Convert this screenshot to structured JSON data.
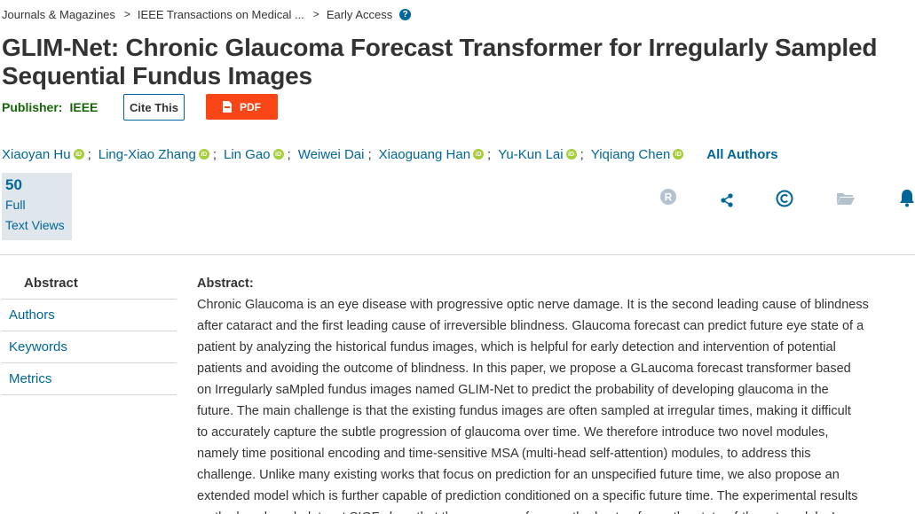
{
  "breadcrumb": {
    "items": [
      "Journals & Magazines",
      "IEEE Transactions on Medical ...",
      "Early Access"
    ],
    "separator": ">"
  },
  "title_lines": [
    "GLIM-Net: Chronic Glaucoma Forecast Transformer for Irregularly Sampled",
    "Sequential Fundus Images"
  ],
  "publisher": {
    "label": "Publisher:",
    "value": "IEEE"
  },
  "buttons": {
    "cite": "Cite This",
    "pdf": "PDF"
  },
  "authors": [
    "Xiaoyan Hu",
    "Ling-Xiao Zhang",
    "Lin Gao",
    "Weiwei Dai",
    "Xiaoguang Han",
    "Yu-Kun Lai",
    "Yiqiang Chen"
  ],
  "author_separator": ";",
  "all_authors": "All Authors",
  "metrics": {
    "count": "50",
    "label_line1": "Full",
    "label_line2": "Text Views"
  },
  "action_icons": [
    "rights-icon",
    "share-icon",
    "copyright-icon",
    "folder-icon",
    "alert-bell-icon"
  ],
  "nav": {
    "items": [
      "Abstract",
      "Authors",
      "Keywords",
      "Metrics"
    ],
    "active": "Abstract"
  },
  "abstract": {
    "heading": "Abstract:",
    "lines": [
      "Chronic Glaucoma is an eye disease with progressive optic nerve damage. It is the second leading cause of blindness",
      "after cataract and the first leading cause of irreversible blindness. Glaucoma forecast can predict future eye state of a",
      "patient by analyzing the historical fundus images, which is helpful for early detection and intervention of potential",
      "patients and avoiding the outcome of blindness. In this paper, we propose a GLaucoma forecast transformer based",
      "on Irregularly saMpled fundus images named GLIM-Net to predict the probability of developing glaucoma in the",
      "future. The main challenge is that the existing fundus images are often sampled at irregular times, making it difficult",
      "to accurately capture the subtle progression of glaucoma over time. We therefore introduce two novel modules,",
      "namely time positional encoding and time-sensitive MSA (multi-head self-attention) modules, to address this",
      "challenge. Unlike many existing works that focus on prediction for an unspecified future time, we also propose an",
      "extended model which is further capable of prediction conditioned on a specific future time. The experimental results",
      "on the benchmark dataset SIGF show that the accuracy of our method outperforms the state-of-the-art models. In"
    ]
  },
  "colors": {
    "link": "#006699",
    "publisher": "#156606",
    "pdf_button": "#fa4616",
    "orcid": "#a6ce39",
    "metrics_bg": "#dfe6ec",
    "icon_blue": "#006699",
    "icon_gray": "#b3c2cf"
  }
}
